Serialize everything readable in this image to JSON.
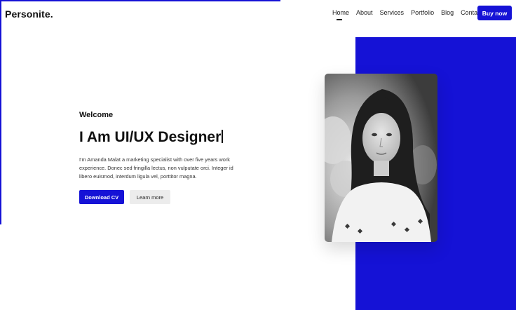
{
  "brand": {
    "logo_text": "Personite.",
    "accent_color": "#1512d6"
  },
  "nav": {
    "items": [
      {
        "label": "Home",
        "active": true
      },
      {
        "label": "About"
      },
      {
        "label": "Services"
      },
      {
        "label": "Portfolio"
      },
      {
        "label": "Blog"
      },
      {
        "label": "Contact"
      }
    ],
    "cta_label": "Buy now"
  },
  "hero": {
    "welcome": "Welcome",
    "headline": "I Am UI/UX Designer",
    "description": "I'm Amanda Malat a marketing specialist with over five years work experience. Donec sed fringilla lectus, non vulputate orci. Integer id libero euismod, interdum ligula vel, porttitor magna.",
    "primary_button": "Download CV",
    "secondary_button": "Learn more"
  },
  "photo": {
    "subject": "portrait-of-woman",
    "style": "black-and-white"
  }
}
